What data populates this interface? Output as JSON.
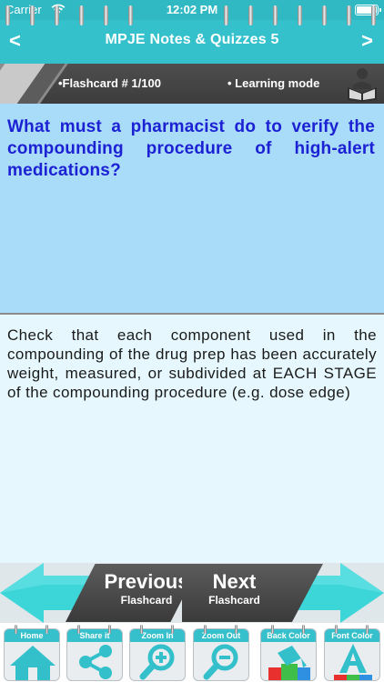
{
  "status_bar": {
    "carrier": "Carrier",
    "time": "12:02 PM"
  },
  "nav": {
    "title": "MPJE Notes & Quizzes 5",
    "prev_glyph": "<",
    "next_glyph": ">"
  },
  "banner": {
    "flashcard_label": "•Flashcard #  1/100",
    "mode_label": "• Learning mode",
    "icon": "reader-icon"
  },
  "card": {
    "question": "What must a pharmacist do to verify the compounding procedure of high-alert medications?",
    "answer": "Check that each component used in the compounding of the drug prep has been accurately weight, measured, or subdivided at EACH STAGE of the compounding procedure (e.g. dose edge)"
  },
  "flash_nav": {
    "previous_title": "Previous",
    "previous_sub": "Flashcard",
    "next_title": "Next",
    "next_sub": "Flashcard"
  },
  "toolbar": [
    {
      "label": "Home",
      "icon": "home-icon"
    },
    {
      "label": "Share it",
      "icon": "share-icon"
    },
    {
      "label": "Zoom In",
      "icon": "zoom-in-icon"
    },
    {
      "label": "Zoom Out",
      "icon": "zoom-out-icon"
    },
    {
      "label": "Back Color",
      "icon": "paint-bucket-icon"
    },
    {
      "label": "Font Color",
      "icon": "font-color-icon"
    }
  ],
  "colors": {
    "accent": "#34c1cc",
    "question_bg": "#a9dcf8",
    "question_text": "#1c22d4",
    "answer_bg": "#e6f8fd"
  }
}
